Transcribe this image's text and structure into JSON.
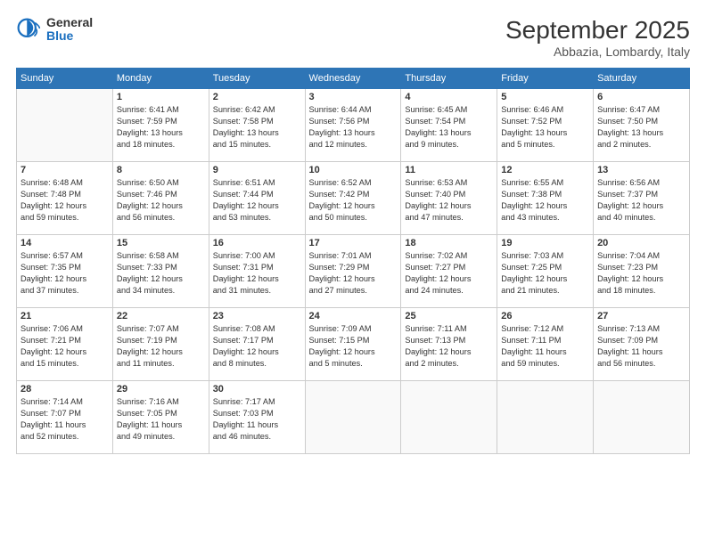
{
  "logo": {
    "general": "General",
    "blue": "Blue"
  },
  "header": {
    "month": "September 2025",
    "location": "Abbazia, Lombardy, Italy"
  },
  "days_of_week": [
    "Sunday",
    "Monday",
    "Tuesday",
    "Wednesday",
    "Thursday",
    "Friday",
    "Saturday"
  ],
  "weeks": [
    [
      {
        "num": "",
        "info": ""
      },
      {
        "num": "1",
        "info": "Sunrise: 6:41 AM\nSunset: 7:59 PM\nDaylight: 13 hours\nand 18 minutes."
      },
      {
        "num": "2",
        "info": "Sunrise: 6:42 AM\nSunset: 7:58 PM\nDaylight: 13 hours\nand 15 minutes."
      },
      {
        "num": "3",
        "info": "Sunrise: 6:44 AM\nSunset: 7:56 PM\nDaylight: 13 hours\nand 12 minutes."
      },
      {
        "num": "4",
        "info": "Sunrise: 6:45 AM\nSunset: 7:54 PM\nDaylight: 13 hours\nand 9 minutes."
      },
      {
        "num": "5",
        "info": "Sunrise: 6:46 AM\nSunset: 7:52 PM\nDaylight: 13 hours\nand 5 minutes."
      },
      {
        "num": "6",
        "info": "Sunrise: 6:47 AM\nSunset: 7:50 PM\nDaylight: 13 hours\nand 2 minutes."
      }
    ],
    [
      {
        "num": "7",
        "info": "Sunrise: 6:48 AM\nSunset: 7:48 PM\nDaylight: 12 hours\nand 59 minutes."
      },
      {
        "num": "8",
        "info": "Sunrise: 6:50 AM\nSunset: 7:46 PM\nDaylight: 12 hours\nand 56 minutes."
      },
      {
        "num": "9",
        "info": "Sunrise: 6:51 AM\nSunset: 7:44 PM\nDaylight: 12 hours\nand 53 minutes."
      },
      {
        "num": "10",
        "info": "Sunrise: 6:52 AM\nSunset: 7:42 PM\nDaylight: 12 hours\nand 50 minutes."
      },
      {
        "num": "11",
        "info": "Sunrise: 6:53 AM\nSunset: 7:40 PM\nDaylight: 12 hours\nand 47 minutes."
      },
      {
        "num": "12",
        "info": "Sunrise: 6:55 AM\nSunset: 7:38 PM\nDaylight: 12 hours\nand 43 minutes."
      },
      {
        "num": "13",
        "info": "Sunrise: 6:56 AM\nSunset: 7:37 PM\nDaylight: 12 hours\nand 40 minutes."
      }
    ],
    [
      {
        "num": "14",
        "info": "Sunrise: 6:57 AM\nSunset: 7:35 PM\nDaylight: 12 hours\nand 37 minutes."
      },
      {
        "num": "15",
        "info": "Sunrise: 6:58 AM\nSunset: 7:33 PM\nDaylight: 12 hours\nand 34 minutes."
      },
      {
        "num": "16",
        "info": "Sunrise: 7:00 AM\nSunset: 7:31 PM\nDaylight: 12 hours\nand 31 minutes."
      },
      {
        "num": "17",
        "info": "Sunrise: 7:01 AM\nSunset: 7:29 PM\nDaylight: 12 hours\nand 27 minutes."
      },
      {
        "num": "18",
        "info": "Sunrise: 7:02 AM\nSunset: 7:27 PM\nDaylight: 12 hours\nand 24 minutes."
      },
      {
        "num": "19",
        "info": "Sunrise: 7:03 AM\nSunset: 7:25 PM\nDaylight: 12 hours\nand 21 minutes."
      },
      {
        "num": "20",
        "info": "Sunrise: 7:04 AM\nSunset: 7:23 PM\nDaylight: 12 hours\nand 18 minutes."
      }
    ],
    [
      {
        "num": "21",
        "info": "Sunrise: 7:06 AM\nSunset: 7:21 PM\nDaylight: 12 hours\nand 15 minutes."
      },
      {
        "num": "22",
        "info": "Sunrise: 7:07 AM\nSunset: 7:19 PM\nDaylight: 12 hours\nand 11 minutes."
      },
      {
        "num": "23",
        "info": "Sunrise: 7:08 AM\nSunset: 7:17 PM\nDaylight: 12 hours\nand 8 minutes."
      },
      {
        "num": "24",
        "info": "Sunrise: 7:09 AM\nSunset: 7:15 PM\nDaylight: 12 hours\nand 5 minutes."
      },
      {
        "num": "25",
        "info": "Sunrise: 7:11 AM\nSunset: 7:13 PM\nDaylight: 12 hours\nand 2 minutes."
      },
      {
        "num": "26",
        "info": "Sunrise: 7:12 AM\nSunset: 7:11 PM\nDaylight: 11 hours\nand 59 minutes."
      },
      {
        "num": "27",
        "info": "Sunrise: 7:13 AM\nSunset: 7:09 PM\nDaylight: 11 hours\nand 56 minutes."
      }
    ],
    [
      {
        "num": "28",
        "info": "Sunrise: 7:14 AM\nSunset: 7:07 PM\nDaylight: 11 hours\nand 52 minutes."
      },
      {
        "num": "29",
        "info": "Sunrise: 7:16 AM\nSunset: 7:05 PM\nDaylight: 11 hours\nand 49 minutes."
      },
      {
        "num": "30",
        "info": "Sunrise: 7:17 AM\nSunset: 7:03 PM\nDaylight: 11 hours\nand 46 minutes."
      },
      {
        "num": "",
        "info": ""
      },
      {
        "num": "",
        "info": ""
      },
      {
        "num": "",
        "info": ""
      },
      {
        "num": "",
        "info": ""
      }
    ]
  ]
}
